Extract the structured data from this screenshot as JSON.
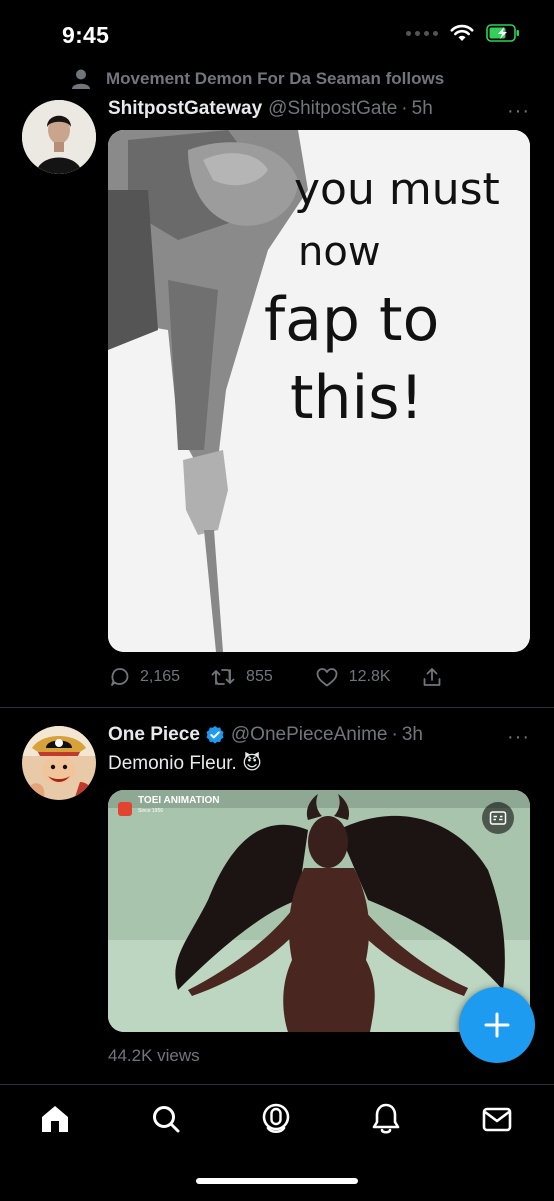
{
  "status_bar": {
    "time": "9:45"
  },
  "tweets": [
    {
      "social_context": "Movement Demon For Da Seaman follows",
      "author": {
        "name": "ShitpostGateway",
        "handle": "@ShitpostGate",
        "time": "5h"
      },
      "media": {
        "meme_text": [
          "you must",
          "now",
          "fap to",
          "this!"
        ]
      },
      "metrics": {
        "replies": "2,165",
        "retweets": "855",
        "likes": "12.8K"
      }
    },
    {
      "author": {
        "name": "One Piece",
        "handle": "@OnePieceAnime",
        "time": "3h",
        "verified": true
      },
      "text": "Demonio Fleur. 😈",
      "media": {
        "watermark": "TOEI ANIMATION",
        "watermark_sub": "Since 1956"
      },
      "views": "44.2K views"
    }
  ],
  "more_label": "···",
  "colors": {
    "accent": "#1d9bf0",
    "secondary_text": "#71767b",
    "divider": "#2f3336",
    "battery": "#30d158"
  },
  "tab_bar": [
    "home-icon",
    "search-icon",
    "spaces-icon",
    "notifications-icon",
    "messages-icon"
  ]
}
